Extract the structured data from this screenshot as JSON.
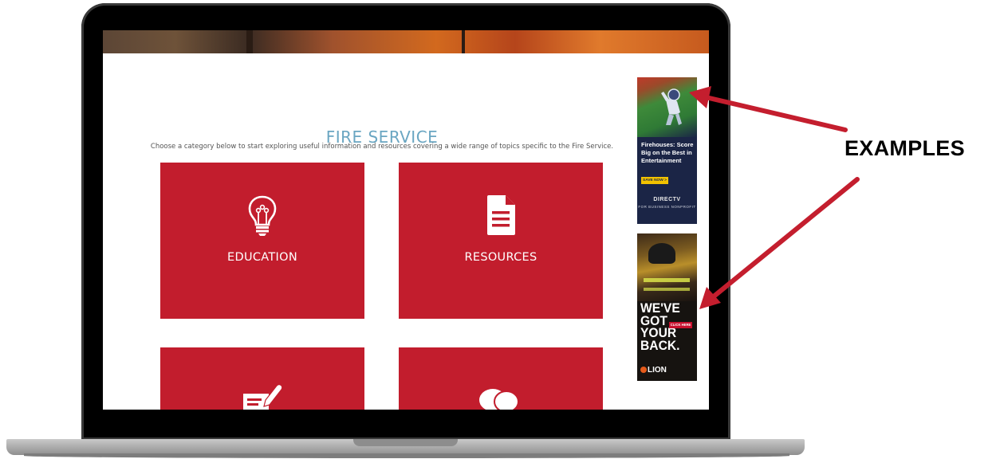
{
  "page": {
    "title": "FIRE SERVICE",
    "subtitle": "Choose a category below to start exploring useful information and resources covering a wide range of topics specific to the Fire Service."
  },
  "categories": [
    {
      "label": "EDUCATION",
      "icon": "lightbulb-icon"
    },
    {
      "label": "RESOURCES",
      "icon": "document-icon"
    },
    {
      "label": "",
      "icon": "form-pen-icon"
    },
    {
      "label": "",
      "icon": "speech-bubbles-icon"
    }
  ],
  "ads": [
    {
      "headline": "Firehouses: Score Big on the Best in Entertainment",
      "cta": "SAVE NOW >",
      "brand": "DIRECTV",
      "brand_sub": "FOR BUSINESS NONPROFIT"
    },
    {
      "headline": "WE'VE GOT YOUR BACK.",
      "cta": "CLICK HERE",
      "brand": "LION"
    }
  ],
  "annotation": {
    "label": "EXAMPLES"
  },
  "colors": {
    "card_red": "#c21d2d",
    "title_blue": "#6aa6c2",
    "arrow_red": "#c41e2e"
  }
}
